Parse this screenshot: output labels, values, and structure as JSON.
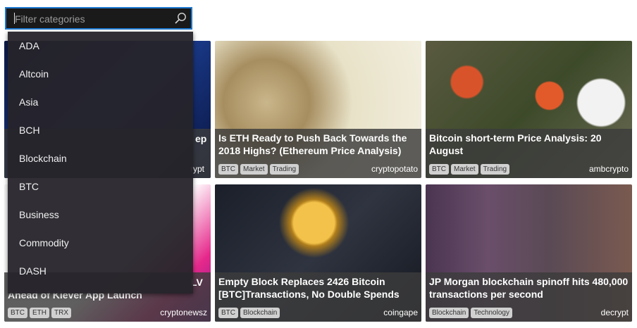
{
  "filter": {
    "placeholder": "Filter categories",
    "options": [
      "ADA",
      "Altcoin",
      "Asia",
      "BCH",
      "Blockchain",
      "BTC",
      "Business",
      "Commodity",
      "DASH"
    ]
  },
  "cards": [
    {
      "title_tail": "ep",
      "source_tail": "rypt",
      "tags": []
    },
    {
      "title": "Is ETH Ready to Push Back Towards the 2018 Highs? (Ethereum Price Analysis)",
      "tags": [
        "BTC",
        "Market",
        "Trading"
      ],
      "source": "cryptopotato"
    },
    {
      "title": "Bitcoin short-term Price Analysis: 20 August",
      "tags": [
        "BTC",
        "Market",
        "Trading"
      ],
      "source": "ambcrypto"
    },
    {
      "title_line1_tail": "LV",
      "title_line2": "Ahead of Klever App Launch",
      "tags": [
        "BTC",
        "ETH",
        "TRX"
      ],
      "source": "cryptonewsz"
    },
    {
      "title": "Empty Block Replaces 2426 Bitcoin [BTC]Transactions, No Double Spends",
      "tags": [
        "BTC",
        "Blockchain"
      ],
      "source": "coingape"
    },
    {
      "title": "JP Morgan blockchain spinoff hits 480,000 transactions per second",
      "tags": [
        "Blockchain",
        "Technology"
      ],
      "source": "decrypt"
    }
  ]
}
